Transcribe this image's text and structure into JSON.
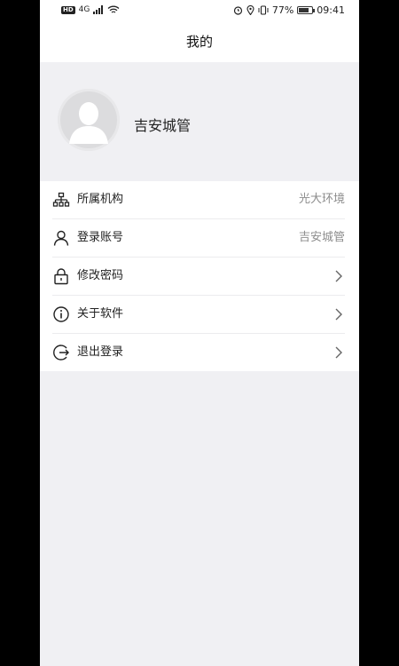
{
  "status_bar": {
    "hd": "HD",
    "network": "4G",
    "battery_pct": "77%",
    "battery_level": 0.77,
    "time": "09:41"
  },
  "header": {
    "title": "我的"
  },
  "profile": {
    "name": "吉安城管"
  },
  "menu": [
    {
      "id": "org",
      "label": "所属机构",
      "value": "光大环境",
      "icon": "org-tree-icon"
    },
    {
      "id": "account",
      "label": "登录账号",
      "value": "吉安城管",
      "icon": "user-icon"
    },
    {
      "id": "password",
      "label": "修改密码",
      "icon": "lock-icon"
    },
    {
      "id": "about",
      "label": "关于软件",
      "icon": "info-icon"
    },
    {
      "id": "logout",
      "label": "退出登录",
      "icon": "logout-icon"
    }
  ]
}
